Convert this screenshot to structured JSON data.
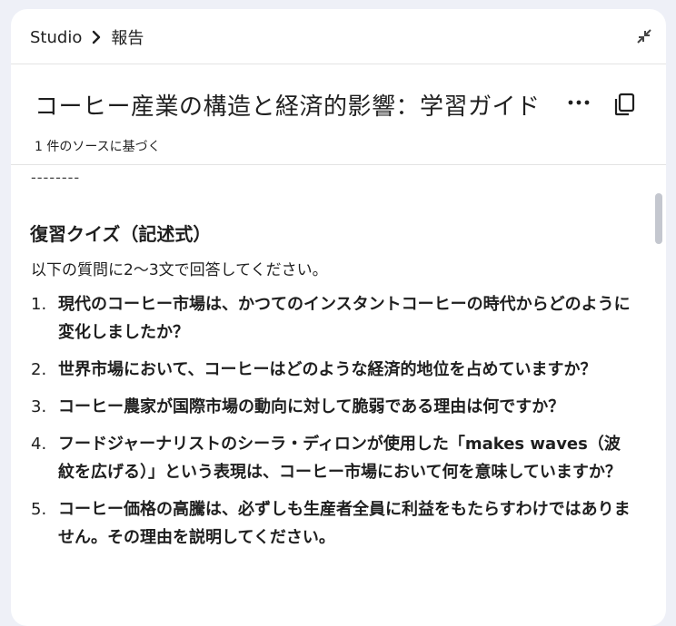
{
  "breadcrumb": {
    "root": "Studio",
    "current": "報告"
  },
  "header": {
    "title": "コーヒー産業の構造と経済的影響：学習ガイド",
    "subtitle": "1 件のソースに基づく"
  },
  "content": {
    "divider": "--------",
    "quiz_heading": "復習クイズ（記述式）",
    "instructions": "以下の質問に2〜3文で回答してください。",
    "questions": [
      {
        "num": "1.",
        "text": "現代のコーヒー市場は、かつてのインスタントコーヒーの時代からどのように変化しましたか？"
      },
      {
        "num": "2.",
        "text": "世界市場において、コーヒーはどのような経済的地位を占めていますか？"
      },
      {
        "num": "3.",
        "text": "コーヒー農家が国際市場の動向に対して脆弱である理由は何ですか？"
      },
      {
        "num": "4.",
        "text": "フードジャーナリストのシーラ・ディロンが使用した「makes waves（波紋を広げる）」という表現は、コーヒー市場において何を意味していますか？"
      },
      {
        "num": "5.",
        "text": "コーヒー価格の高騰は、必ずしも生産者全員に利益をもたらすわけではありません。その理由を説明してください。"
      }
    ]
  },
  "icons": {
    "breadcrumb_separator": "chevron-right-icon",
    "collapse": "collapse-icon",
    "more": "more-horiz-icon",
    "copy": "copy-icon"
  }
}
